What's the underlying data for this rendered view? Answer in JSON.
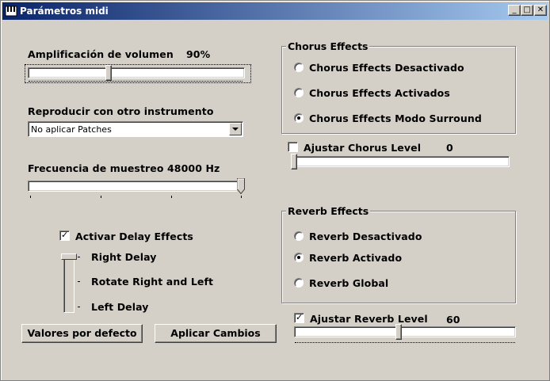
{
  "window": {
    "title": "Parámetros midi",
    "controls": {
      "minimize": "_",
      "maximize": "□",
      "close": "✕"
    },
    "app_icon": "midi-app-icon"
  },
  "volume": {
    "label": "Amplificación de volumen",
    "value_text": "90%",
    "level": 0.37
  },
  "instrument": {
    "label": "Reproducir con otro instrumento",
    "selected": "No aplicar Patches"
  },
  "sampling": {
    "label": "Frecuencia de muestreo",
    "value_text": "48000 Hz",
    "level": 1.0
  },
  "delay": {
    "checkbox_label": "Activar Delay Effects",
    "checked": true,
    "options": [
      "Right Delay",
      "Rotate Right and Left",
      "Left Delay"
    ],
    "selected_index": 0
  },
  "buttons": {
    "defaults": "Valores por defecto",
    "apply": "Aplicar Cambios"
  },
  "chorus": {
    "group_label": "Chorus Effects",
    "options": [
      "Chorus Effects Desactivado",
      "Chorus Effects Activados",
      "Chorus Effects Modo Surround"
    ],
    "selected_index": 2,
    "level_checkbox_label": "Ajustar Chorus Level",
    "level_checked": false,
    "level_value": "0",
    "level": 0.0
  },
  "reverb": {
    "group_label": "Reverb Effects",
    "options": [
      "Reverb Desactivado",
      "Reverb Activado",
      "Reverb Global"
    ],
    "selected_index": 1,
    "level_checkbox_label": "Ajustar Reverb Level",
    "level_checked": true,
    "level_value": "60",
    "level": 0.47
  }
}
